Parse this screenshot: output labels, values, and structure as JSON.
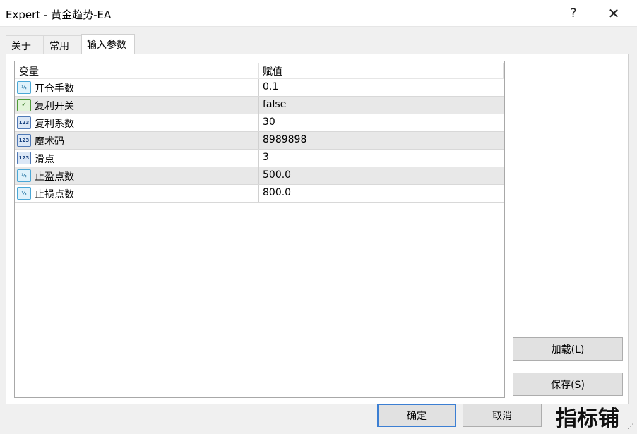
{
  "window": {
    "title": "Expert - 黄金趋势-EA",
    "help_label": "?",
    "close_label": "✕"
  },
  "tabs": [
    {
      "label": "关于",
      "active": false
    },
    {
      "label": "常用",
      "active": false
    },
    {
      "label": "输入参数",
      "active": true
    }
  ],
  "grid": {
    "columns": [
      "变量",
      "赋值"
    ],
    "rows": [
      {
        "icon": "fraction-type-icon",
        "icon_text": "½",
        "name": "开仓手数",
        "value": "0.1"
      },
      {
        "icon": "boolean-type-icon",
        "icon_text": "✓",
        "name": "复利开关",
        "value": "false"
      },
      {
        "icon": "integer-type-icon",
        "icon_text": "123",
        "name": "复利系数",
        "value": "30"
      },
      {
        "icon": "integer-type-icon",
        "icon_text": "123",
        "name": "魔术码",
        "value": "8989898"
      },
      {
        "icon": "integer-type-icon",
        "icon_text": "123",
        "name": "滑点",
        "value": "3"
      },
      {
        "icon": "fraction-type-icon",
        "icon_text": "½",
        "name": "止盈点数",
        "value": "500.0"
      },
      {
        "icon": "fraction-type-icon",
        "icon_text": "½",
        "name": "止损点数",
        "value": "800.0"
      }
    ]
  },
  "buttons": {
    "load": "加载(L)",
    "save": "保存(S)",
    "ok": "确定",
    "cancel": "取消"
  },
  "watermark": "指标铺",
  "colors": {
    "row_alt": "#e8e8e8",
    "primary_border": "#3c7fd3"
  }
}
